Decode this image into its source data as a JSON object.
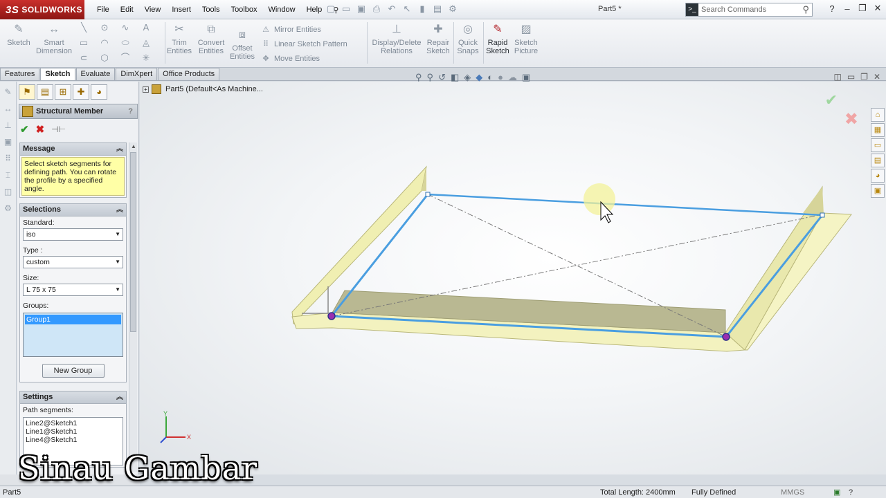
{
  "app": {
    "logo_text": "SOLIDWORKS",
    "logo_mark": "3S",
    "document_title": "Part5 *"
  },
  "menu": [
    "File",
    "Edit",
    "View",
    "Insert",
    "Tools",
    "Toolbox",
    "Window",
    "Help"
  ],
  "search": {
    "placeholder": "Search Commands"
  },
  "ribbon": {
    "sketch": "Sketch",
    "smart_dimension": "Smart Dimension",
    "trim_entities": "Trim Entities",
    "convert_entities": "Convert Entities",
    "offset_entities": "Offset Entities",
    "mirror_entities": "Mirror Entities",
    "linear_sketch_pattern": "Linear Sketch Pattern",
    "move_entities": "Move Entities",
    "display_delete_relations": "Display/Delete Relations",
    "repair_sketch": "Repair Sketch",
    "quick_snaps": "Quick Snaps",
    "rapid_sketch": "Rapid Sketch",
    "sketch_picture": "Sketch Picture"
  },
  "command_tabs": [
    "Features",
    "Sketch",
    "Evaluate",
    "DimXpert",
    "Office Products"
  ],
  "active_command_tab": "Sketch",
  "property_manager": {
    "title": "Structural Member",
    "help": "?",
    "message": {
      "header": "Message",
      "text": "Select sketch segments for defining path. You can rotate the profile by a specified angle."
    },
    "selections": {
      "header": "Selections",
      "standard_label": "Standard:",
      "standard_value": "iso",
      "type_label": "Type :",
      "type_value": "custom",
      "size_label": "Size:",
      "size_value": "L 75 x 75",
      "groups_label": "Groups:",
      "groups": [
        "Group1"
      ],
      "new_group_button": "New Group"
    },
    "settings": {
      "header": "Settings",
      "path_segments_label": "Path segments:",
      "path_segments": [
        "Line2@Sketch1",
        "Line1@Sketch1",
        "Line4@Sketch1"
      ]
    }
  },
  "viewport": {
    "tree_item": "Part5  (Default<As Machine..."
  },
  "status": {
    "left": "Part5",
    "total_length": "Total Length: 2400mm",
    "state": "Fully Defined",
    "units": "MMGS"
  },
  "watermark": "Sinau Gambar",
  "colors": {
    "logo_red": "#b3232a",
    "sketch_line": "#4a9ee0",
    "member_face": "#f1f0b5",
    "message_bg": "#ffffa6"
  }
}
